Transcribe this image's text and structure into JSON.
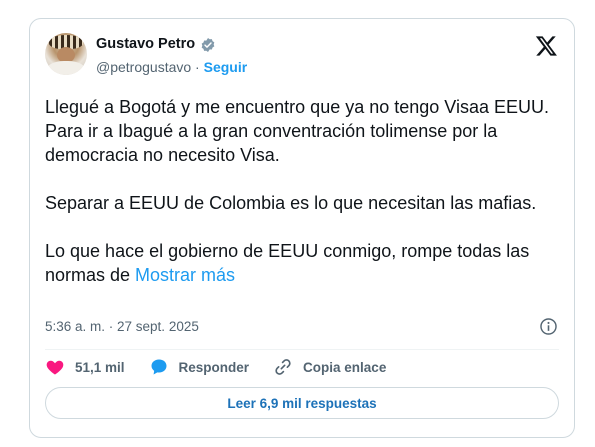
{
  "author": {
    "name": "Gustavo Petro",
    "handle": "@petrogustavo",
    "separator": " · ",
    "follow_label": "Seguir"
  },
  "tweet": {
    "text": "Llegué a Bogotá y me encuentro que ya no tengo Visaa EEUU. Para ir a Ibagué a la gran conventración tolimense por la democracia no necesito Visa.\n\nSeparar a EEUU de Colombia es lo que necesitan las mafias.\n\nLo que hace el gobierno de EEUU conmigo, rompe todas las normas de ",
    "show_more_label": "Mostrar más",
    "timestamp": "5:36 a. m. · 27 sept. 2025"
  },
  "actions": {
    "likes": "51,1 mil",
    "reply_label": "Responder",
    "copy_label": "Copia enlace"
  },
  "read_replies_label": "Leer 6,9 mil respuestas",
  "colors": {
    "accent": "#1d9bf0",
    "like": "#f91880",
    "text": "#0f1419",
    "muted": "#536471",
    "border": "#cfd9de"
  },
  "icons": [
    "verified-badge-icon",
    "x-logo-icon",
    "info-icon",
    "heart-icon",
    "reply-bubble-icon",
    "link-icon"
  ]
}
